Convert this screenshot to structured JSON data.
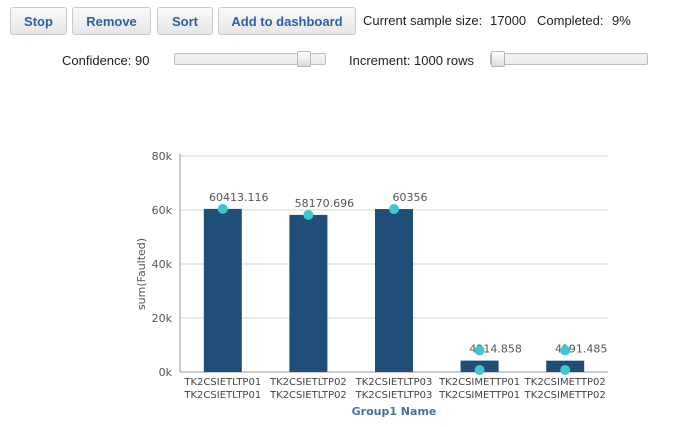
{
  "toolbar": {
    "stop_label": "Stop",
    "remove_label": "Remove",
    "sort_label": "Sort",
    "add_dashboard_label": "Add to dashboard",
    "sample_size_label": "Current sample size:",
    "sample_size_value": "17000",
    "completed_label": "Completed:",
    "completed_value": "9%"
  },
  "controls": {
    "confidence_label": "Confidence: 90",
    "confidence_fraction": 0.9,
    "increment_label": "Increment: 1000 rows",
    "increment_fraction": 0.0
  },
  "colors": {
    "bar": "#1f4e79",
    "point": "#3ec6d2",
    "axis_label": "#4a6fa5"
  },
  "chart_data": {
    "type": "bar",
    "categories": [
      [
        "TK2CSIETLTP01",
        "TK2CSIETLTP01"
      ],
      [
        "TK2CSIETLTP02",
        "TK2CSIETLTP02"
      ],
      [
        "TK2CSIETLTP03",
        "TK2CSIETLTP03"
      ],
      [
        "TK2CSIMETTP01",
        "TK2CSIMETTP01"
      ],
      [
        "TK2CSIMETTP02",
        "TK2CSIMETTP02"
      ]
    ],
    "values": [
      60413.116,
      58170.696,
      60356,
      4214.858,
      4191.485
    ],
    "data_labels": [
      "60413.116",
      "58170.696",
      "60356",
      "4214.858",
      "4191.485"
    ],
    "points": [
      [
        60413.116
      ],
      [
        58170.696
      ],
      [
        60356
      ],
      [
        8000,
        0
      ],
      [
        8000,
        0
      ]
    ],
    "xlabel": "Group1 Name",
    "ylabel": "sum(Faulted)",
    "ylim": [
      0,
      80000
    ],
    "yticks": [
      0,
      20000,
      40000,
      60000,
      80000
    ],
    "ytick_labels": [
      "0k",
      "20k",
      "40k",
      "60k",
      "80k"
    ],
    "grid": true
  }
}
